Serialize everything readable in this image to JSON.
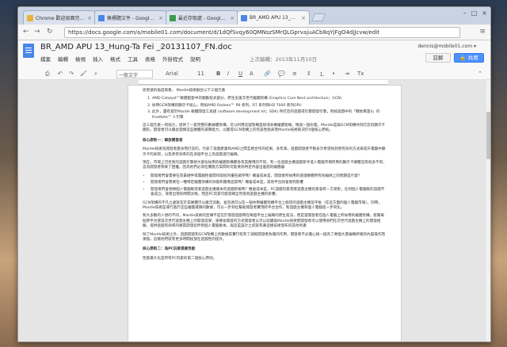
{
  "tabs": [
    {
      "label": "Chrome 歡迎頁面完成設定",
      "color": "#e8b33a"
    },
    {
      "label": "無標題文件 - Google 文件",
      "color": "#4a86e8"
    },
    {
      "label": "最近存取處 - Google 雲端硬碟",
      "color": "#3d9a4f"
    },
    {
      "label": "BR_AMD APU 13_Hung-Ta Fei",
      "color": "#4a86e8"
    }
  ],
  "address": "https://docs.google.com/a/mobile01.com/document/d/1dQfSvqy60QMNszSMrQLGprvajuACb8qYjFgO4djJcvw/edit",
  "doc": {
    "title": "BR_AMD APU 13_Hung-Ta Fei _20131107_FN.doc",
    "menus": [
      "檔案",
      "編輯",
      "檢視",
      "插入",
      "格式",
      "工具",
      "表格",
      "外掛程式",
      "說明"
    ],
    "last_edit": "上次編輯：2013年11月10日",
    "user": "dennis@mobile01.com ▾",
    "comment_label": "註解",
    "share_label": "共用",
    "style_select": "一般文字",
    "font_select": "Arial",
    "size_select": "11"
  },
  "content": {
    "intro": "從更遠的角度來看， Mantle技術融合以下三個元素",
    "list": [
      "AMD Catalyst™軟體配套中的驅動程式部分，原生支援次世代繪圖架構 (Graphics Core Next architecture；GCN)",
      "採用GCN架構的顯示卡核心，例如AMD Radeon™ R9 系列、R7 系列和HD 7000 系列GPU",
      "此外，還有基於Mantle 軟體開發工具組 (software development kit；SDK) 所打造的遊戲或引擎開發引擎，例如遊戲中的「戰地風雲4」的Frostbite™ 3 引擎"
    ],
    "para1": "這三個元素一同協力，提供了一套完整的數據體架構，可以利用這個架構直接或本機繪圖管線，精減一個份量。Mantle是與GCN架構共同打造的顯示卡圖形，開發者可以藉此發揮這些硬體的運算能力，以獲得GCN架構上的完美性能表現Mantle技術取決於4個核心原則。",
    "h1": "核心原則一：解放開發者",
    "para2": "Mantle技術為開發者量身而打造的，代表了遊戲產業和AMD之間互相合作的結果。多年來，遊戲開發者不斷表示希望找到更有效的方式來提升電腦中顯示卡的表現，以及更有效率的在多個平台上為遊戲進行編碼。",
    "para3": "現在，市場上可見到的遊戲引擎絕大部份採用的繪圖架構都各有其應用的不同。有一位遊戲主機遊戲新手進入電腦市場所用的顯示卡硬體沒有很多不同，這為開發者帶來了困擾。因為他們必須在實施方案間的可能要為特定內容出差錯的繪圖器",
    "bullets": [
      "開發者們會需要在昂貴硬件或電腦性能間作取捨的優先順序嗎？機會成本是，開發者所採用的基礎硬體所有效編碼上的問題是什麼？",
      "開發者們會需要在一種特定繪圖架構的效能和圖像品質嗎？機會成本是，其他平台則會受到影響",
      "開發者們會想將個人電腦版或者遊戲主機版本的遊戲移植嗎？機會成本是，PC遊戲玩家或者遊戲主機玩家會有一方受影，任何個人電腦版的遊戲不會成立，或者出現的時間太晚，而且PC玩家可能發揮全然受到遊戲主機的影響。"
    ],
    "para4": "GCN架構的不凡之處就在於其硬體可以廣泛流動，並且適可以在一個共用繪圖架構平台上組得的遊戲主機及平板（在這方面的個人電腦市場）。同時，Mantle技術是運行基於這些繪圖選擇的數據，可以一步到位幫助開發者實現跨平台合作，對遊戲主機和個人電腦進一步同化。",
    "para5": "和大多數的人想的不同，Mantle技術的宣傳不是在於開發遊戲時在每個平台上編碼的原生寫法，而是當開發者在個人電腦上所採用的繪圖架構，能幫每個原平台使其次世代遊戲主機上的開發成果，來節省開發的方式開發者以可以延續與Mantle技術使開發者可以使用他們在次世代遊戲主機上的開發經驗，提供遊戲有效率的將其開發延伸到個人電腦版本，與這是設計之初就有著這樣技術發布的其他考慮",
    "para6": "除了Mantle技術之外，遊戲開發和GCN架構上的數據其實行程有了減輕開發者負擔的作用，開發者不必擔心統一個為了要個大量編碼所確的內容操作而煩惱，這樣他們就有更多時間投放在遊戲性的提升。",
    "h2": "核心原則二：為PC玩家提高性能",
    "para7": "性能最大化是所有PC玩家的第二個核心原則。",
    "frostbite_link": "Frostbite™ 3"
  }
}
